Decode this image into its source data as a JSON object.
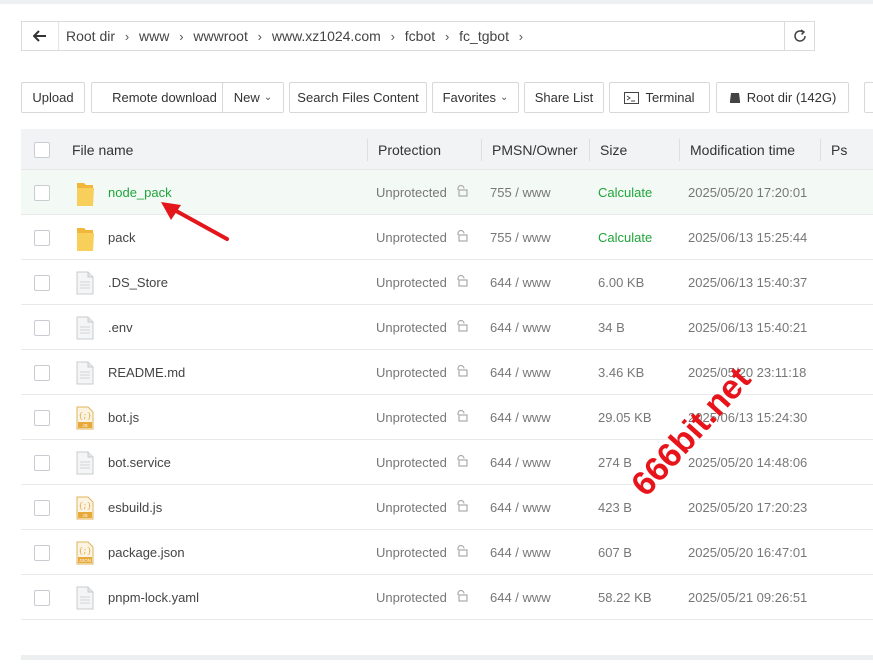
{
  "breadcrumb": {
    "items": [
      "Root dir",
      "www",
      "wwwroot",
      "www.xz1024.com",
      "fcbot",
      "fc_tgbot"
    ]
  },
  "toolbar": {
    "upload": "Upload",
    "remote_download": "Remote download",
    "new": "New",
    "search_files": "Search Files Content",
    "favorites": "Favorites",
    "share_list": "Share List",
    "terminal": "Terminal",
    "root_dir": "Root dir (142G)"
  },
  "table": {
    "headers": {
      "name": "File name",
      "protection": "Protection",
      "pmsn": "PMSN/Owner",
      "size": "Size",
      "mtime": "Modification time",
      "ps": "Ps"
    },
    "rows": [
      {
        "name": "node_pack",
        "type": "folder",
        "protection": "Unprotected",
        "perm": "755 / www",
        "size": "Calculate",
        "mtime": "2025/05/20 17:20:01"
      },
      {
        "name": "pack",
        "type": "folder",
        "protection": "Unprotected",
        "perm": "755 / www",
        "size": "Calculate",
        "mtime": "2025/06/13 15:25:44"
      },
      {
        "name": ".DS_Store",
        "type": "file",
        "protection": "Unprotected",
        "perm": "644 / www",
        "size": "6.00 KB",
        "mtime": "2025/06/13 15:40:37"
      },
      {
        "name": ".env",
        "type": "file",
        "protection": "Unprotected",
        "perm": "644 / www",
        "size": "34 B",
        "mtime": "2025/06/13 15:40:21"
      },
      {
        "name": "README.md",
        "type": "file",
        "protection": "Unprotected",
        "perm": "644 / www",
        "size": "3.46 KB",
        "mtime": "2025/05/20 23:11:18"
      },
      {
        "name": "bot.js",
        "type": "js",
        "protection": "Unprotected",
        "perm": "644 / www",
        "size": "29.05 KB",
        "mtime": "2025/06/13 15:24:30"
      },
      {
        "name": "bot.service",
        "type": "file",
        "protection": "Unprotected",
        "perm": "644 / www",
        "size": "274 B",
        "mtime": "2025/05/20 14:48:06"
      },
      {
        "name": "esbuild.js",
        "type": "js",
        "protection": "Unprotected",
        "perm": "644 / www",
        "size": "423 B",
        "mtime": "2025/05/20 17:20:23"
      },
      {
        "name": "package.json",
        "type": "json",
        "protection": "Unprotected",
        "perm": "644 / www",
        "size": "607 B",
        "mtime": "2025/05/20 16:47:01"
      },
      {
        "name": "pnpm-lock.yaml",
        "type": "file",
        "protection": "Unprotected",
        "perm": "644 / www",
        "size": "58.22 KB",
        "mtime": "2025/05/21 09:26:51"
      }
    ]
  },
  "icons": {
    "js_badge": "JS",
    "json_badge": "JSON"
  },
  "watermark": "666bit.net",
  "colors": {
    "accent_green": "#20a53a",
    "arrow_red": "#e3161c",
    "folder_yellow": "#f8c74a"
  }
}
